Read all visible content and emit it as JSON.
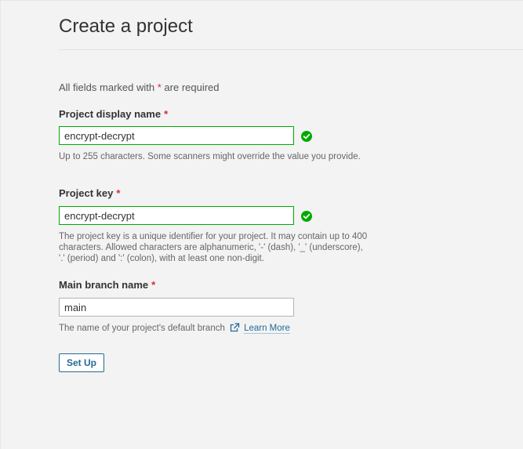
{
  "page": {
    "title": "Create a project",
    "required_note_prefix": "All fields marked with",
    "required_star": "*",
    "required_note_suffix": "are required"
  },
  "form": {
    "display_name": {
      "label": "Project display name",
      "value": "encrypt-decrypt",
      "help": "Up to 255 characters. Some scanners might override the value you provide.",
      "status": "valid"
    },
    "project_key": {
      "label": "Project key",
      "value": "encrypt-decrypt",
      "help": "The project key is a unique identifier for your project. It may contain up to 400 characters. Allowed characters are alphanumeric, '-' (dash), '_' (underscore), '.' (period) and ':' (colon), with at least one non-digit.",
      "status": "valid"
    },
    "main_branch": {
      "label": "Main branch name",
      "value": "main",
      "help": "The name of your project's default branch",
      "learn_more": "Learn More"
    },
    "setup_button": "Set Up"
  },
  "colors": {
    "valid_green": "#00aa00",
    "required_red": "#d02f3a",
    "link_blue": "#236a97",
    "background": "#f3f3f3"
  },
  "icons": [
    "check-circle-icon",
    "external-link-icon"
  ]
}
